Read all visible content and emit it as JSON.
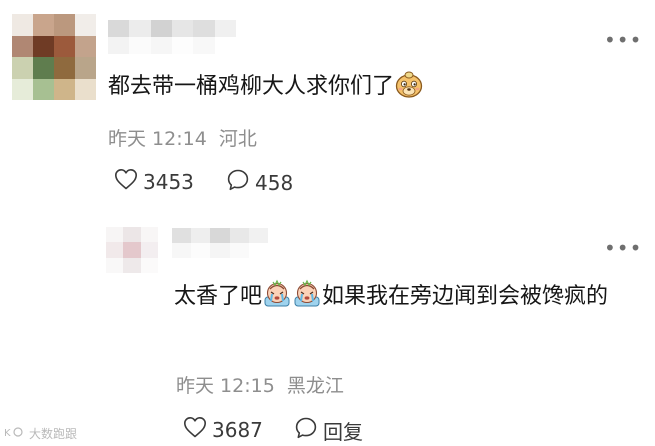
{
  "comment": {
    "text": "都去带一桶鸡柳大人求你们了",
    "time": "昨天 12:14",
    "location": "河北",
    "likes": "3453",
    "replies": "458",
    "emoji": "doge-icon"
  },
  "reply": {
    "text_before": "太香了吧",
    "text_after": "如果我在旁边闻到会被馋疯的",
    "time": "昨天 12:15",
    "location": "黑龙江",
    "likes": "3687",
    "reply_label": "回复",
    "emoji": "crying-face-icon"
  },
  "watermark": "大数跑跟",
  "icons": [
    "more-icon",
    "like-heart-icon",
    "comment-bubble-icon",
    "watermark-logo-icon"
  ],
  "colors": {
    "text": "#161616",
    "meta": "#8e8e8e",
    "icon": "#3a3a3a",
    "background": "#ffffff"
  }
}
